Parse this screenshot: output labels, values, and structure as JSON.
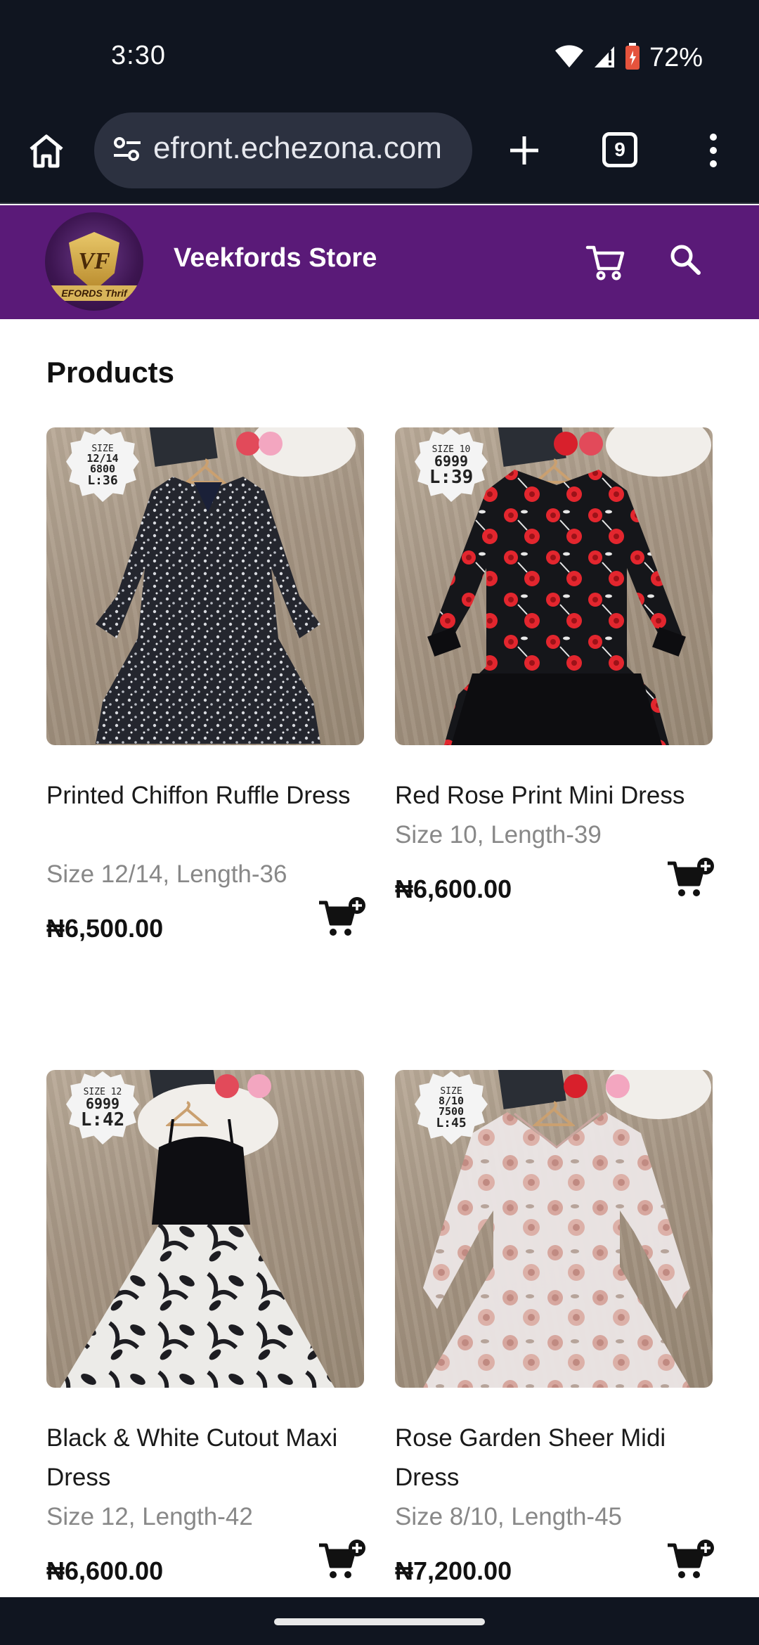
{
  "status_bar": {
    "time": "3:30",
    "battery_percent": "72%",
    "battery_level": 0.72
  },
  "browser": {
    "url": "efront.echezona.com",
    "tab_count": "9"
  },
  "store": {
    "logo_letters": "VF",
    "logo_ribbon": "EFORDS Thrif",
    "name": "Veekfords Store",
    "accent_color": "#5a1a78"
  },
  "products_section": {
    "title": "Products",
    "items": [
      {
        "name": "Printed Chiffon Ruffle Dress",
        "subtitle": "Size 12/14, Length-36",
        "price": "₦6,500.00",
        "tag_lines": [
          "SIZE",
          "12/14",
          "6800",
          "L:36"
        ],
        "print": "black-ditsy-floral"
      },
      {
        "name": "Red Rose Print Mini Dress",
        "subtitle": "Size 10, Length-39",
        "price": "₦6,600.00",
        "tag_lines": [
          "SIZE 10",
          "6999",
          "L:39"
        ],
        "print": "black-red-rose"
      },
      {
        "name": "Black & White Cutout Maxi Dress",
        "subtitle": "Size 12, Length-42",
        "price": "₦6,600.00",
        "tag_lines": [
          "SIZE 12",
          "6999",
          "L:42"
        ],
        "print": "white-black-floral"
      },
      {
        "name": "Rose Garden Sheer Midi Dress",
        "subtitle": "Size 8/10, Length-45",
        "price": "₦7,200.00",
        "tag_lines": [
          "SIZE",
          "8/10",
          "7500",
          "L:45"
        ],
        "print": "white-pink-rose"
      }
    ]
  }
}
